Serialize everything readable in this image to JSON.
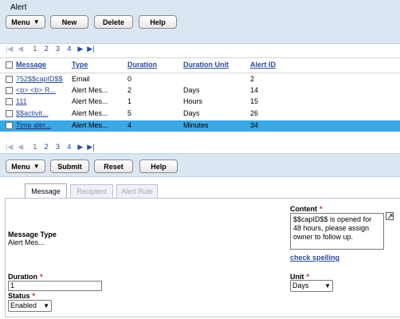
{
  "header": {
    "title": "Alert"
  },
  "toolbar1": {
    "menu": "Menu",
    "new": "New",
    "delete": "Delete",
    "help": "Help"
  },
  "pager": {
    "pages": [
      "1",
      "2",
      "3",
      "4"
    ]
  },
  "table": {
    "headers": [
      "Message",
      "Type",
      "Duration",
      "Duration Unit",
      "Alert ID"
    ],
    "rows": [
      {
        "message": "752$$capID$$",
        "type": "Email",
        "duration": "0",
        "unit": "",
        "id": "2",
        "selected": false
      },
      {
        "message": "<p> <b> R...",
        "type": "Alert Mes...",
        "duration": "2",
        "unit": "Days",
        "id": "14",
        "selected": false
      },
      {
        "message": "111",
        "type": "Alert Mes...",
        "duration": "1",
        "unit": "Hours",
        "id": "15",
        "selected": false
      },
      {
        "message": "$$activit...",
        "type": "Alert Mes...",
        "duration": "5",
        "unit": "Days",
        "id": "26",
        "selected": false
      },
      {
        "message": "Time aler...",
        "type": "Alert Mes...",
        "duration": "4",
        "unit": "Minutes",
        "id": "34",
        "selected": true
      }
    ]
  },
  "toolbar2": {
    "menu": "Menu",
    "submit": "Submit",
    "reset": "Reset",
    "help": "Help"
  },
  "tabs": [
    {
      "label": "Message",
      "active": true
    },
    {
      "label": "Recipient",
      "active": false
    },
    {
      "label": "Alert Rule",
      "active": false
    }
  ],
  "form": {
    "message_type_label": "Message Type",
    "message_type_value": "Alert Mes...",
    "content_label": "Content",
    "content_value": "$$capID$$ is opened for 48 hours, please assign owner to follow up.",
    "check_spelling": "check spelling",
    "duration_label": "Duration",
    "duration_value": "1",
    "unit_label": "Unit",
    "unit_value": "Days",
    "status_label": "Status",
    "status_value": "Enabled",
    "required_mark": "*"
  },
  "colors": {
    "header_bg": "#dbe6f3",
    "link": "#2b4b9b",
    "selected_row": "#3aa8e4",
    "required": "#d62020"
  }
}
